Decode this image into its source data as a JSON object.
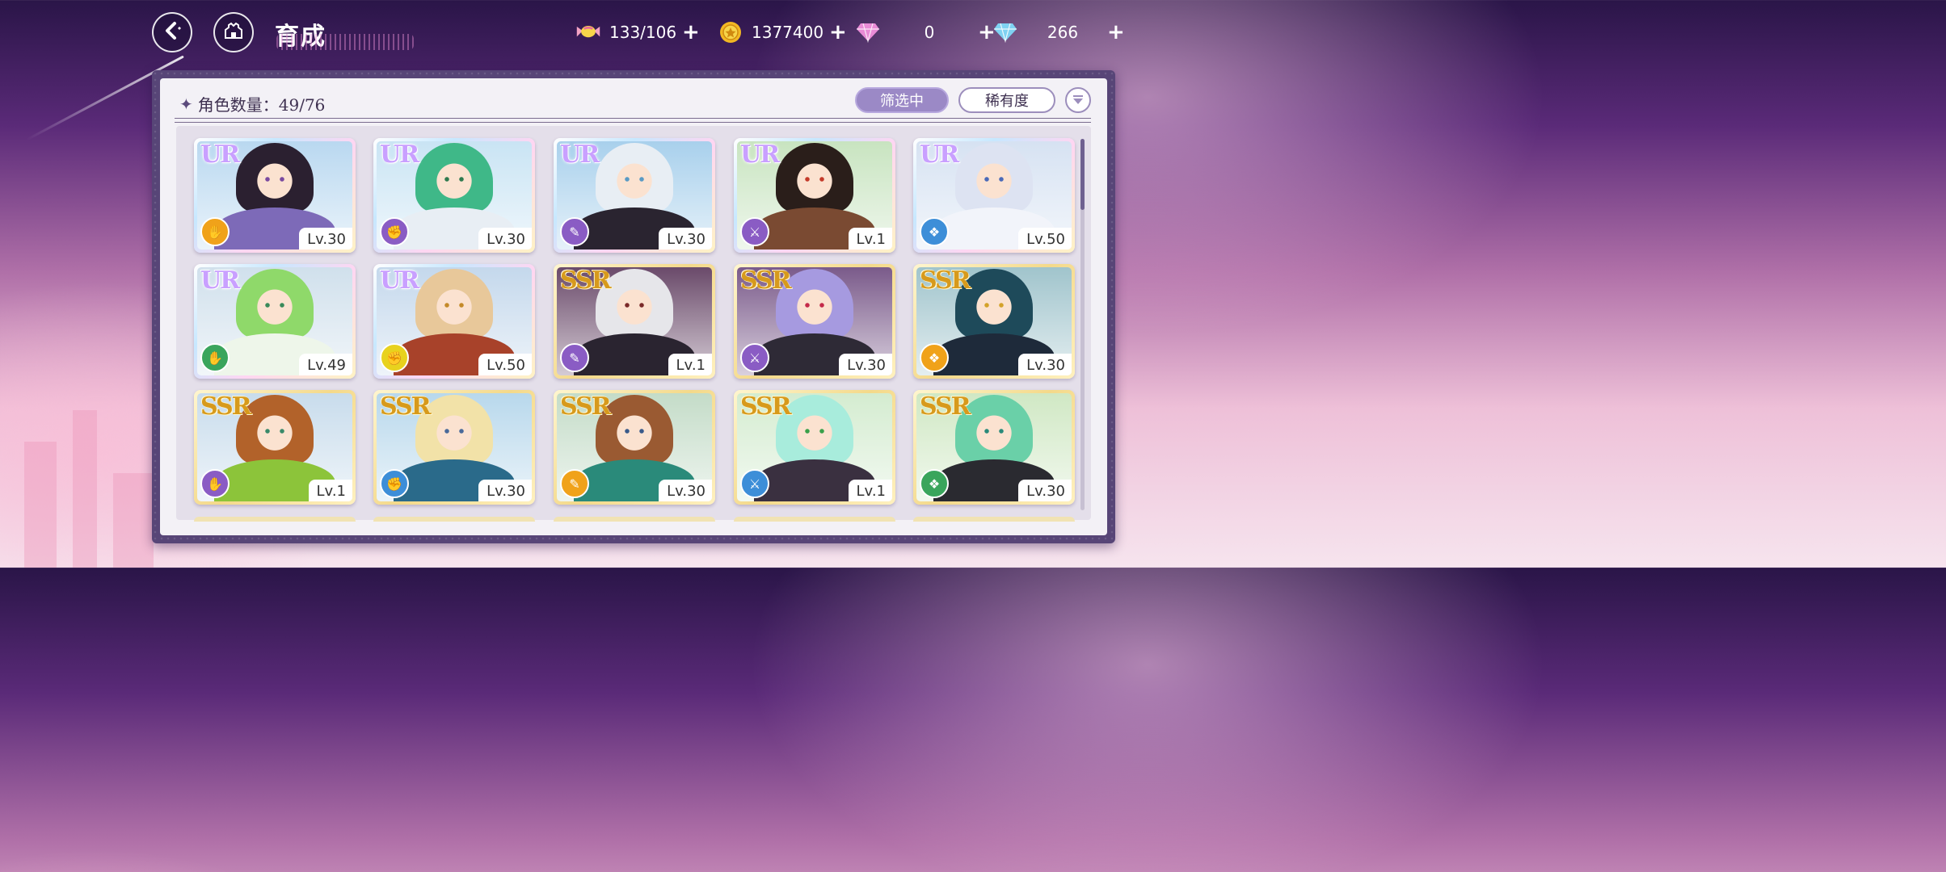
{
  "header": {
    "title": "育成",
    "resources": [
      {
        "icon": "candy-icon",
        "value": "133/106"
      },
      {
        "icon": "gold-coin-icon",
        "value": "1377400"
      },
      {
        "icon": "pink-diamond-icon",
        "value": "0"
      },
      {
        "icon": "blue-diamond-icon",
        "value": "266"
      }
    ]
  },
  "panel": {
    "count_label": "角色数量：49/76",
    "filter_label": "筛选中",
    "sort_label": "稀有度"
  },
  "cards": [
    {
      "rarity": "UR",
      "level": "Lv.30",
      "class_color": "#f0a21a",
      "hair": "#2b2030",
      "outfit": "#7d6ab8",
      "eye": "#7a4aa0",
      "bg": "#b9d8f0"
    },
    {
      "rarity": "UR",
      "level": "Lv.30",
      "class_color": "#8a5cc4",
      "hair": "#3fb888",
      "outfit": "#e8eef4",
      "eye": "#2f7a4f",
      "bg": "#c9e4f4"
    },
    {
      "rarity": "UR",
      "level": "Lv.30",
      "class_color": "#8a5cc4",
      "hair": "#e8eef4",
      "outfit": "#2a2430",
      "eye": "#5a9ac4",
      "bg": "#a8d0ec"
    },
    {
      "rarity": "UR",
      "level": "Lv.1",
      "class_color": "#8a5cc4",
      "hair": "#2a1e1a",
      "outfit": "#7a4a32",
      "eye": "#c43a2a",
      "bg": "#c8e4c0"
    },
    {
      "rarity": "UR",
      "level": "Lv.50",
      "class_color": "#3d8ed8",
      "hair": "#dde3f2",
      "outfit": "#f2f4fa",
      "eye": "#4a6ab8",
      "bg": "#d6e2f2"
    },
    {
      "rarity": "UR",
      "level": "Lv.49",
      "class_color": "#3aa55c",
      "hair": "#8fd96a",
      "outfit": "#eef6ea",
      "eye": "#3a8a5a",
      "bg": "#d0e0ec"
    },
    {
      "rarity": "UR",
      "level": "Lv.50",
      "class_color": "#e8d21e",
      "hair": "#e8c89a",
      "outfit": "#a8422a",
      "eye": "#c48a2a",
      "bg": "#c4d8ec"
    },
    {
      "rarity": "SSR",
      "level": "Lv.1",
      "class_color": "#8a5cc4",
      "hair": "#e6e6ea",
      "outfit": "#2a2430",
      "eye": "#7a2a2a",
      "bg": "#6a4a6a"
    },
    {
      "rarity": "SSR",
      "level": "Lv.30",
      "class_color": "#8a5cc4",
      "hair": "#a69ae0",
      "outfit": "#2e2a36",
      "eye": "#c42a4a",
      "bg": "#7a5a8a"
    },
    {
      "rarity": "SSR",
      "level": "Lv.30",
      "class_color": "#f0a21a",
      "hair": "#1e4a5a",
      "outfit": "#1e2a3a",
      "eye": "#d4a22a",
      "bg": "#a0c4cc"
    },
    {
      "rarity": "SSR",
      "level": "Lv.1",
      "class_color": "#8a5cc4",
      "hair": "#b2622a",
      "outfit": "#8cc43a",
      "eye": "#3a8a6a",
      "bg": "#c8dcec"
    },
    {
      "rarity": "SSR",
      "level": "Lv.30",
      "class_color": "#3d8ed8",
      "hair": "#f2e2a8",
      "outfit": "#2a6a8a",
      "eye": "#4a6a9a",
      "bg": "#b8d8ec"
    },
    {
      "rarity": "SSR",
      "level": "Lv.30",
      "class_color": "#f0a21a",
      "hair": "#9a5a32",
      "outfit": "#2a8a7a",
      "eye": "#3a5a8a",
      "bg": "#c4dcc8"
    },
    {
      "rarity": "SSR",
      "level": "Lv.1",
      "class_color": "#3d8ed8",
      "hair": "#a8ecdc",
      "outfit": "#3a3040",
      "eye": "#3aa04a",
      "bg": "#d4ecd0"
    },
    {
      "rarity": "SSR",
      "level": "Lv.30",
      "class_color": "#3aa55c",
      "hair": "#6ad0a8",
      "outfit": "#2a2a30",
      "eye": "#2a8a7a",
      "bg": "#d0e8c4"
    }
  ]
}
